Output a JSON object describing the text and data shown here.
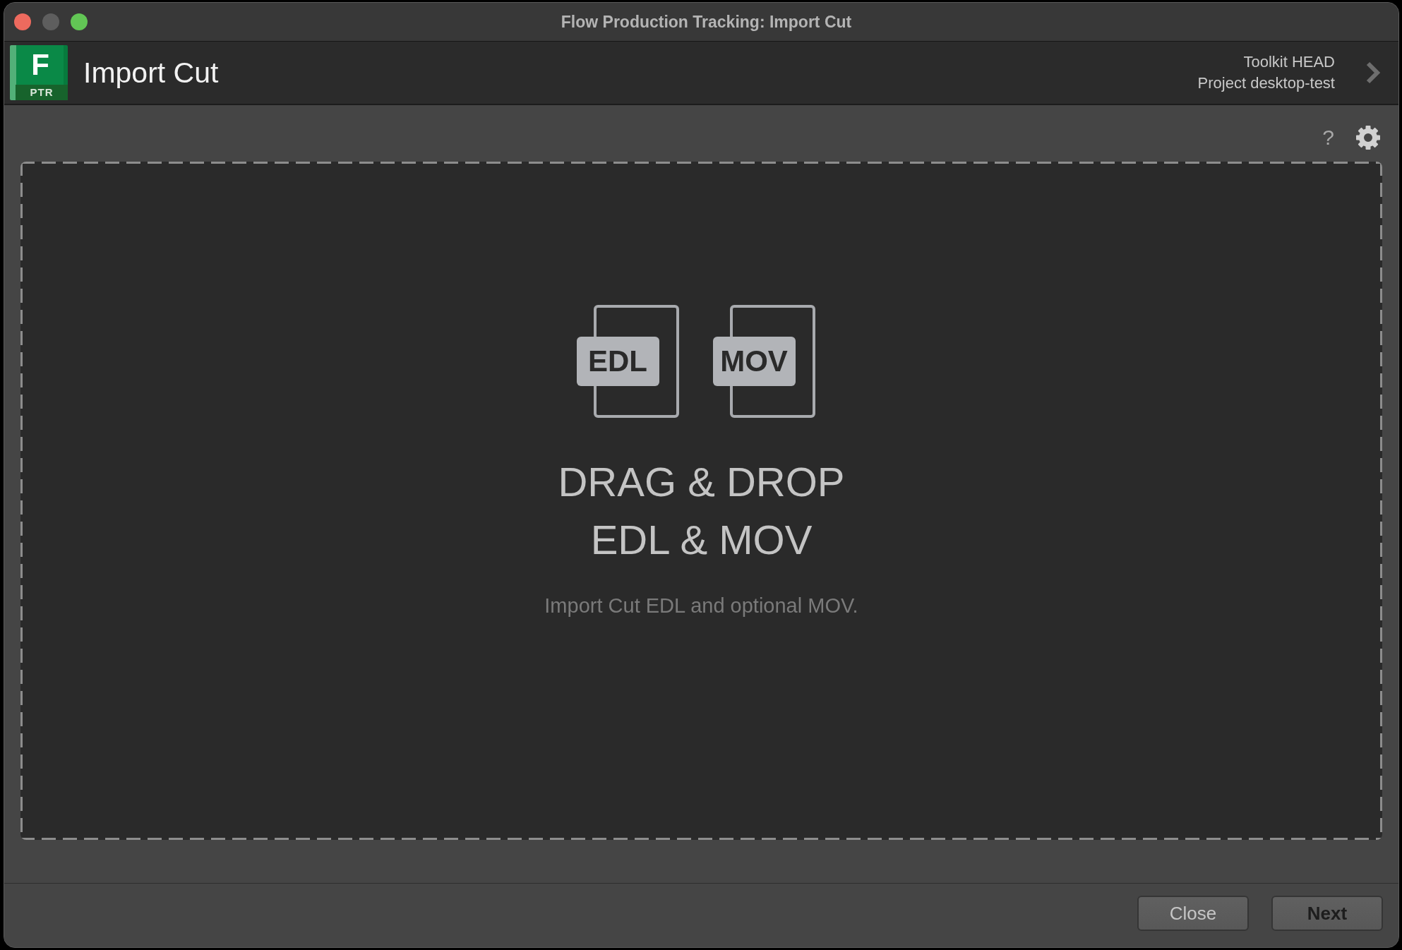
{
  "window": {
    "title": "Flow Production Tracking: Import Cut",
    "controls": [
      {
        "color": "#ed6a5e"
      },
      {
        "color": "#5e5e5e"
      },
      {
        "color": "#62c655"
      }
    ]
  },
  "header": {
    "logo": {
      "letter": "F",
      "badge": "PTR"
    },
    "title": "Import Cut",
    "context_lines": [
      "Toolkit HEAD",
      "Project desktop-test"
    ]
  },
  "toolbar": {
    "help": "?"
  },
  "drop_zone": {
    "file_types": [
      "EDL",
      "MOV"
    ],
    "heading_lines": [
      "DRAG & DROP",
      "EDL & MOV"
    ],
    "hint": "Import Cut EDL and optional MOV."
  },
  "buttons": [
    {
      "label": "Close",
      "default": false
    },
    {
      "label": "Next",
      "default": true
    }
  ]
}
